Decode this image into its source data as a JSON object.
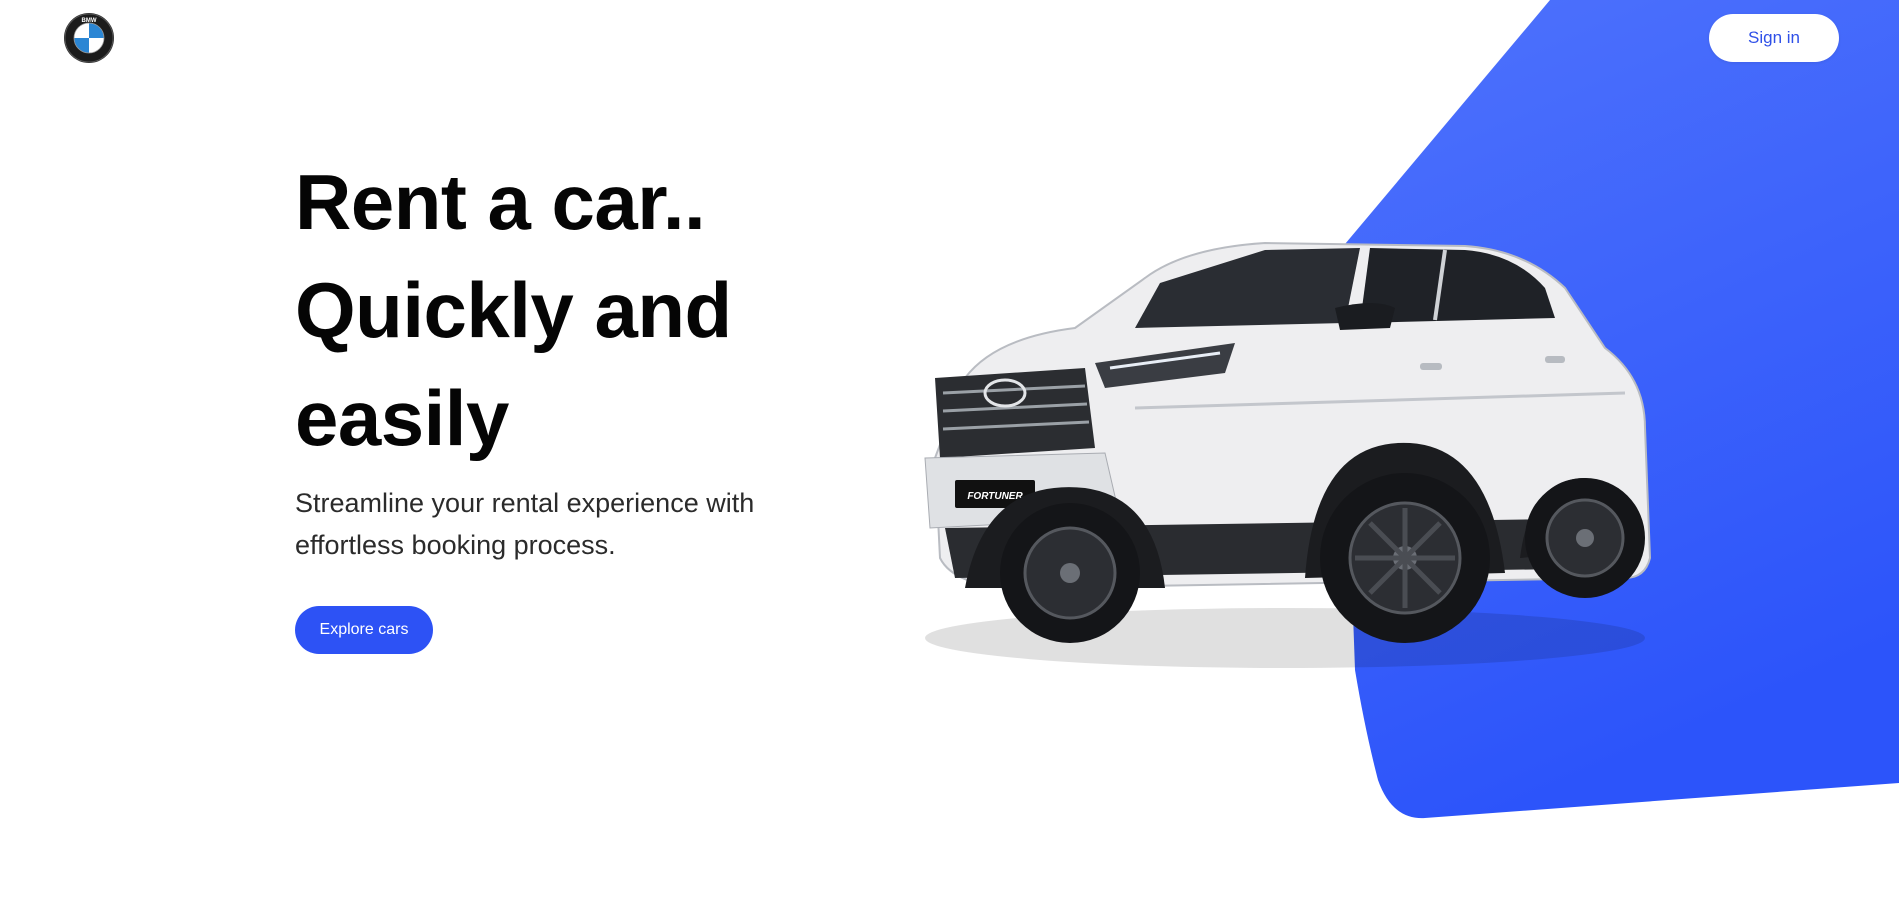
{
  "brand": {
    "logo_icon": "bmw-roundel-logo-icon",
    "logo_letters": "BMW"
  },
  "header": {
    "signin_label": "Sign in"
  },
  "hero": {
    "headline_line1": "Rent a car..",
    "headline_line2": "Quickly and",
    "headline_line3": "easily",
    "subtext_line1": "Streamline your rental experience with",
    "subtext_line2": "effortless booking process.",
    "cta_label": "Explore cars"
  },
  "car_image": {
    "icon": "white-suv-car-icon",
    "plate_text": "FORTUNER"
  },
  "colors": {
    "accent": "#2d52f5",
    "accent_light": "#4b6ffb",
    "text": "#050505",
    "background": "#ffffff"
  }
}
